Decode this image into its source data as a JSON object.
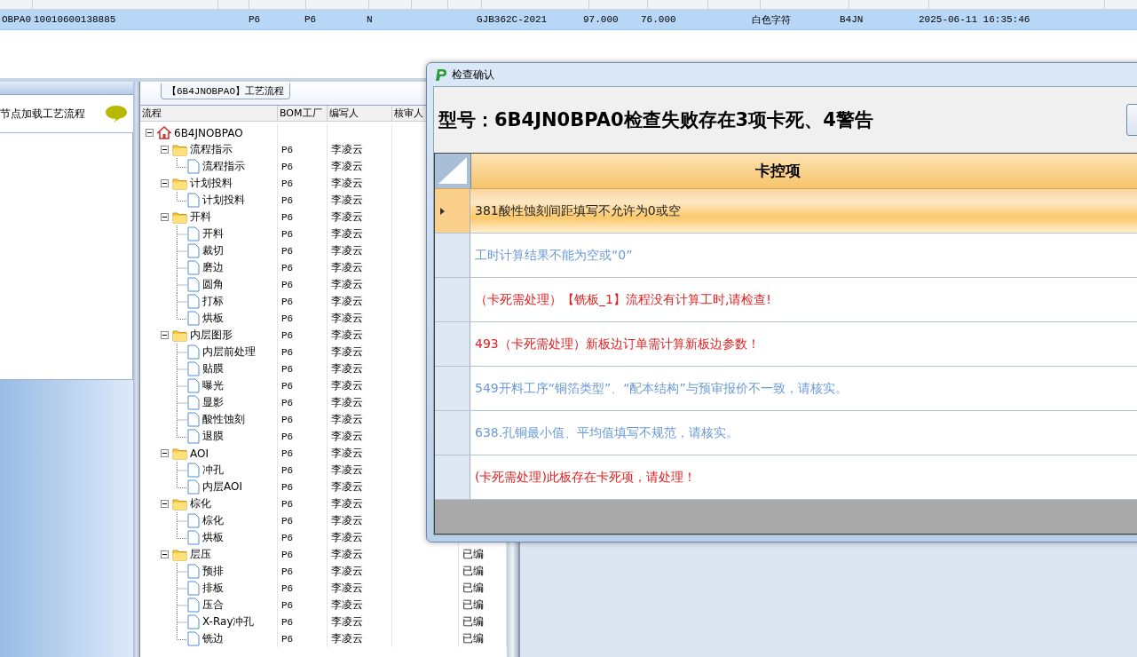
{
  "top_table": {
    "rows": [
      {
        "selected": true,
        "cells": [
          "OBPA0",
          "10010600138885",
          "",
          "P6",
          "P6",
          "N",
          "",
          "",
          "GJB362C-2021",
          "97.000",
          "76.000",
          "",
          "白色字符",
          "B4JN",
          "2025-06-11 16:35:46",
          ""
        ]
      }
    ]
  },
  "left_panel": {
    "title": "节点加载工艺流程"
  },
  "process_panel": {
    "title": "【6B4JNOBPAO】工艺流程",
    "columns": [
      "流程",
      "BOM工厂",
      "编写人",
      "核审人"
    ],
    "tree": [
      {
        "name": "6B4JNOBPAO",
        "expanded": true,
        "children": [
          {
            "name": "流程指示",
            "bom": "P6",
            "writer": "李凌云",
            "expanded": true,
            "children": [
              {
                "name": "流程指示",
                "bom": "P6",
                "writer": "李凌云"
              }
            ]
          },
          {
            "name": "计划投料",
            "bom": "P6",
            "writer": "李凌云",
            "expanded": true,
            "children": [
              {
                "name": "计划投料",
                "bom": "P6",
                "writer": "李凌云"
              }
            ]
          },
          {
            "name": "开料",
            "bom": "P6",
            "writer": "李凌云",
            "expanded": true,
            "children": [
              {
                "name": "开料",
                "bom": "P6",
                "writer": "李凌云"
              },
              {
                "name": "裁切",
                "bom": "P6",
                "writer": "李凌云"
              },
              {
                "name": "磨边",
                "bom": "P6",
                "writer": "李凌云"
              },
              {
                "name": "圆角",
                "bom": "P6",
                "writer": "李凌云"
              },
              {
                "name": "打标",
                "bom": "P6",
                "writer": "李凌云"
              },
              {
                "name": "烘板",
                "bom": "P6",
                "writer": "李凌云"
              }
            ]
          },
          {
            "name": "内层图形",
            "bom": "P6",
            "writer": "李凌云",
            "expanded": true,
            "children": [
              {
                "name": "内层前处理",
                "bom": "P6",
                "writer": "李凌云"
              },
              {
                "name": "贴膜",
                "bom": "P6",
                "writer": "李凌云"
              },
              {
                "name": "曝光",
                "bom": "P6",
                "writer": "李凌云"
              },
              {
                "name": "显影",
                "bom": "P6",
                "writer": "李凌云"
              },
              {
                "name": "酸性蚀刻",
                "bom": "P6",
                "writer": "李凌云"
              },
              {
                "name": "退膜",
                "bom": "P6",
                "writer": "李凌云"
              }
            ]
          },
          {
            "name": "AOI",
            "bom": "P6",
            "writer": "李凌云",
            "expanded": true,
            "children": [
              {
                "name": "冲孔",
                "bom": "P6",
                "writer": "李凌云"
              },
              {
                "name": "内层AOI",
                "bom": "P6",
                "writer": "李凌云"
              }
            ]
          },
          {
            "name": "棕化",
            "bom": "P6",
            "writer": "李凌云",
            "expanded": true,
            "children": [
              {
                "name": "棕化",
                "bom": "P6",
                "writer": "李凌云"
              },
              {
                "name": "烘板",
                "bom": "P6",
                "writer": "李凌云"
              }
            ]
          },
          {
            "name": "层压",
            "bom": "P6",
            "writer": "李凌云",
            "status": "已编",
            "expanded": true,
            "children": [
              {
                "name": "预排",
                "bom": "P6",
                "writer": "李凌云",
                "status": "已编"
              },
              {
                "name": "排板",
                "bom": "P6",
                "writer": "李凌云",
                "status": "已编"
              },
              {
                "name": "压合",
                "bom": "P6",
                "writer": "李凌云",
                "status": "已编"
              },
              {
                "name": "X-Ray冲孔",
                "bom": "P6",
                "writer": "李凌云",
                "status": "已编"
              },
              {
                "name": "铣边",
                "bom": "P6",
                "writer": "李凌云",
                "status": "已编"
              }
            ]
          }
        ]
      }
    ]
  },
  "dialog": {
    "title": "检查确认",
    "heading": "型号：6B4JN0BPA0检查失败存在3项卡死、4警告",
    "column": "卡控项",
    "items": [
      {
        "text": "381酸性蚀刻间距填写不允许为0或空",
        "color": "#222222",
        "selected": true
      },
      {
        "text": "工时计算结果不能为空或“0”",
        "color": "#6a9ad6",
        "selected": false
      },
      {
        "text": "（卡死需处理）【铣板_1】流程没有计算工时,请检查!",
        "color": "#e02020",
        "selected": false
      },
      {
        "text": "493（卡死需处理）新板边订单需计算新板边参数！",
        "color": "#e02020",
        "selected": false
      },
      {
        "text": "549开料工序“铜箔类型”、“配本结构”与预审报价不一致，请核实。",
        "color": "#6a9ad6",
        "selected": false
      },
      {
        "text": "638.孔铜最小值、平均值填写不规范，请核实。",
        "color": "#6a9ad6",
        "selected": false
      },
      {
        "text": "(卡死需处理)此板存在卡死项，请处理！",
        "color": "#e02020",
        "selected": false
      }
    ]
  }
}
